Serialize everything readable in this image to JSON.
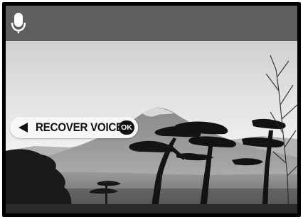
{
  "header": {
    "icon": "microphone-icon"
  },
  "playback": {
    "action_label": "RECOVER VOICE",
    "ok_label": "OK",
    "back_icon": "left-arrow-icon"
  },
  "photo": {
    "subject": "mountain-landscape"
  }
}
